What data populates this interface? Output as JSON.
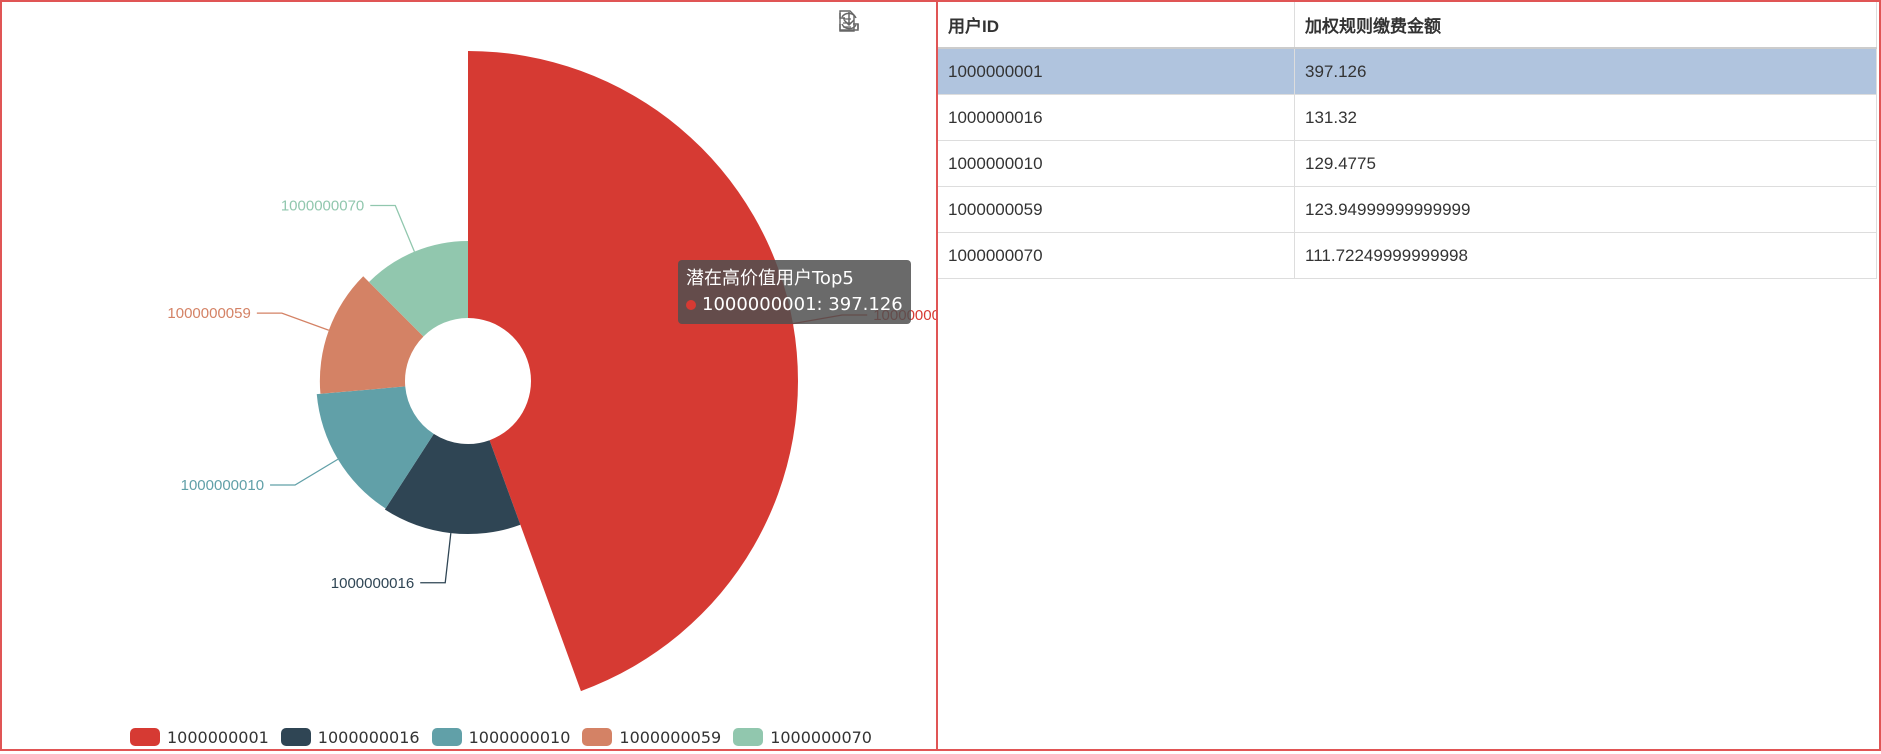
{
  "chart_data": {
    "type": "pie",
    "variant": "nightingale-rose",
    "title": "潜在高价值用户Top5",
    "categories": [
      "1000000001",
      "1000000016",
      "1000000010",
      "1000000059",
      "1000000070"
    ],
    "values": [
      397.126,
      131.32,
      129.4775,
      123.94999999999999,
      111.72249999999998
    ],
    "colors": [
      "#d63a33",
      "#2f4554",
      "#61a0a8",
      "#d48265",
      "#91c7ae"
    ],
    "legend_position": "bottom",
    "label_colors": [
      "#d63a33",
      "#2f4554",
      "#61a0a8",
      "#d48265",
      "#91c7ae"
    ]
  },
  "tooltip": {
    "title": "潜在高价值用户Top5",
    "line": "1000000001: 397.126",
    "dot_color": "#d63a33"
  },
  "toolbox": {
    "icons": [
      "data-view-icon",
      "restore-icon",
      "save-image-icon"
    ]
  },
  "table": {
    "headers": [
      "用户ID",
      "加权规则缴费金额"
    ],
    "rows": [
      [
        "1000000001",
        "397.126"
      ],
      [
        "1000000016",
        "131.32"
      ],
      [
        "1000000010",
        "129.4775"
      ],
      [
        "1000000059",
        "123.94999999999999"
      ],
      [
        "1000000070",
        "111.72249999999998"
      ]
    ],
    "selected_row": 0,
    "selected_color": "#b0c4de"
  }
}
